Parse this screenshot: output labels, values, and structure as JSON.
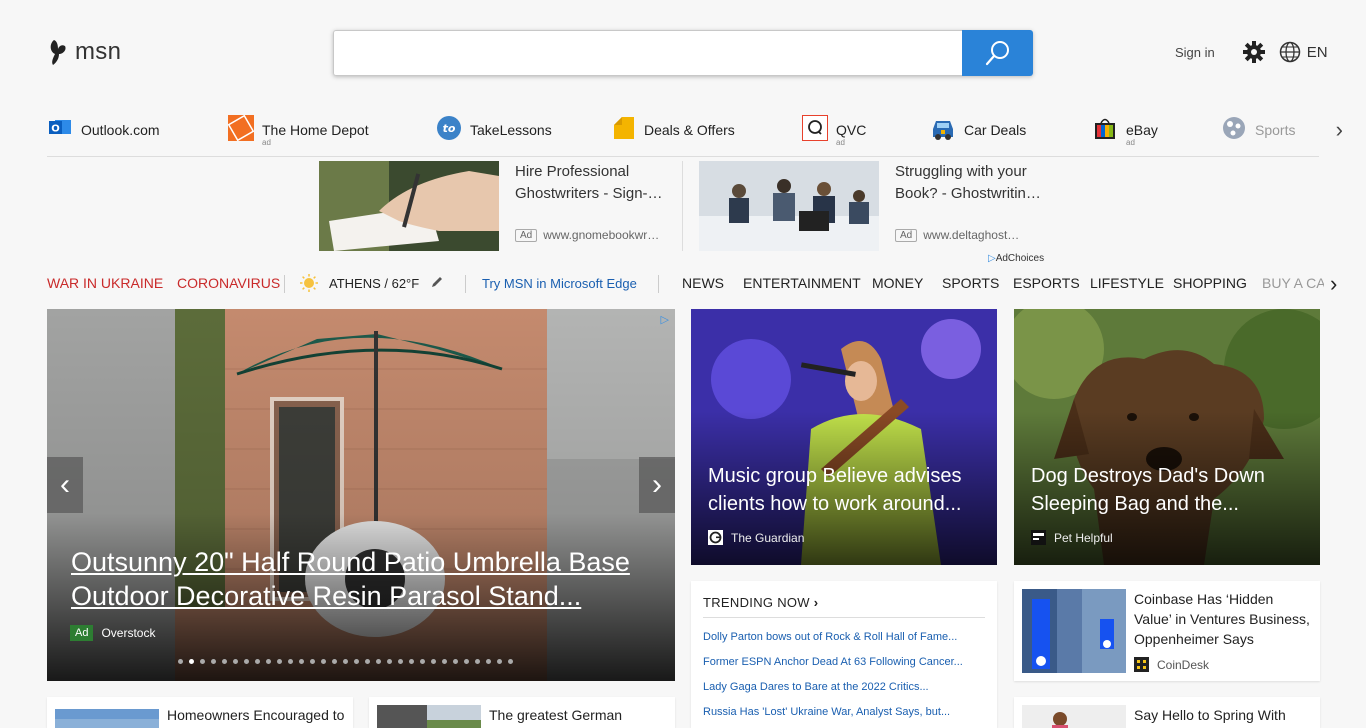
{
  "header": {
    "logo_text": "msn",
    "search": {
      "placeholder": "",
      "value": ""
    },
    "signin_label": "Sign in",
    "language": "EN"
  },
  "quick_links": [
    {
      "label": "Outlook.com",
      "ad": "",
      "icon": "outlook-icon"
    },
    {
      "label": "The Home Depot",
      "ad": "ad",
      "icon": "home-depot-icon"
    },
    {
      "label": "TakeLessons",
      "ad": "",
      "icon": "takelessons-icon"
    },
    {
      "label": "Deals & Offers",
      "ad": "",
      "icon": "deals-tag-icon"
    },
    {
      "label": "QVC",
      "ad": "ad",
      "icon": "qvc-icon"
    },
    {
      "label": "Car Deals",
      "ad": "",
      "icon": "car-icon"
    },
    {
      "label": "eBay",
      "ad": "ad",
      "icon": "ebay-bag-icon"
    },
    {
      "label": "Sports",
      "ad": "",
      "icon": "sports-ball-icon"
    }
  ],
  "ads": [
    {
      "title": "Hire Professional Ghostwriters - Sign-…",
      "tag": "Ad",
      "domain": "www.gnomebookwr…"
    },
    {
      "title": "Struggling with your Book? - Ghostwritin…",
      "tag": "Ad",
      "domain": "www.deltaghost…"
    }
  ],
  "adchoices_label": "AdChoices",
  "nav": {
    "war": "WAR IN UKRAINE",
    "corona": "CORONAVIRUS",
    "weather": "ATHENS / 62°F",
    "edge": "Try MSN in Microsoft Edge",
    "items": [
      "NEWS",
      "ENTERTAINMENT",
      "MONEY",
      "SPORTS",
      "ESPORTS",
      "LIFESTYLE",
      "SHOPPING",
      "BUY A CA"
    ]
  },
  "hero": {
    "title": "Outsunny 20\" Half Round Patio Umbrella Base Outdoor Decorative Resin Parasol Stand...",
    "ad_tag": "Ad",
    "source": "Overstock",
    "dot_count": 31,
    "active_dot": 1
  },
  "cards": [
    {
      "title": "Music group Believe advises clients how to work around...",
      "source": "The Guardian"
    },
    {
      "title": "Dog Destroys Dad's Down Sleeping Bag and the...",
      "source": "Pet Helpful"
    }
  ],
  "trending": {
    "heading": "TRENDING NOW",
    "items": [
      "Dolly Parton bows out of Rock & Roll Hall of Fame...",
      "Former ESPN Anchor Dead At 63 Following Cancer...",
      "Lady Gaga Dares to Bare at the 2022 Critics...",
      "Russia Has 'Lost' Ukraine War, Analyst Says, but..."
    ]
  },
  "small_cards": [
    {
      "title": "Coinbase Has ‘Hidden Value’ in Ventures Business, Oppenheimer Says",
      "source": "CoinDesk"
    },
    {
      "title": "Homeowners Encouraged to",
      "source": ""
    },
    {
      "title": "The greatest German",
      "source": ""
    },
    {
      "title": "Say Hello to Spring With",
      "source": ""
    }
  ],
  "colors": {
    "accent": "#2a83d8",
    "nav_red": "#c92a2a",
    "link_blue": "#1a5fb0",
    "ad_green": "#2d7d32"
  }
}
